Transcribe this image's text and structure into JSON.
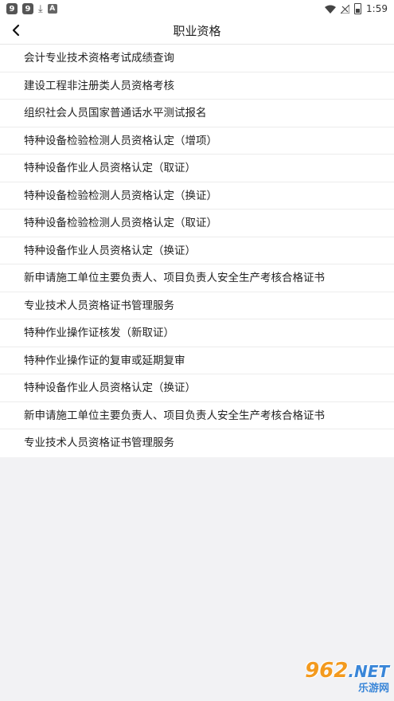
{
  "status_bar": {
    "notif1": "9",
    "notif2": "9",
    "a_badge": "A",
    "time": "1:59"
  },
  "header": {
    "title": "职业资格"
  },
  "items": [
    {
      "label": "会计专业技术资格考试成绩查询"
    },
    {
      "label": "建设工程非注册类人员资格考核"
    },
    {
      "label": "组织社会人员国家普通话水平测试报名"
    },
    {
      "label": "特种设备检验检测人员资格认定（增项）"
    },
    {
      "label": "特种设备作业人员资格认定（取证）"
    },
    {
      "label": "特种设备检验检测人员资格认定（换证）"
    },
    {
      "label": "特种设备检验检测人员资格认定（取证）"
    },
    {
      "label": "特种设备作业人员资格认定（换证）"
    },
    {
      "label": "新申请施工单位主要负责人、项目负责人安全生产考核合格证书"
    },
    {
      "label": "专业技术人员资格证书管理服务"
    },
    {
      "label": "特种作业操作证核发（新取证）"
    },
    {
      "label": "特种作业操作证的复审或延期复审"
    },
    {
      "label": "特种设备作业人员资格认定（换证）"
    },
    {
      "label": "新申请施工单位主要负责人、项目负责人安全生产考核合格证书"
    },
    {
      "label": "专业技术人员资格证书管理服务"
    }
  ],
  "watermark": {
    "big_text": "962",
    "net_text": ".NET",
    "small_text": "乐游网"
  }
}
